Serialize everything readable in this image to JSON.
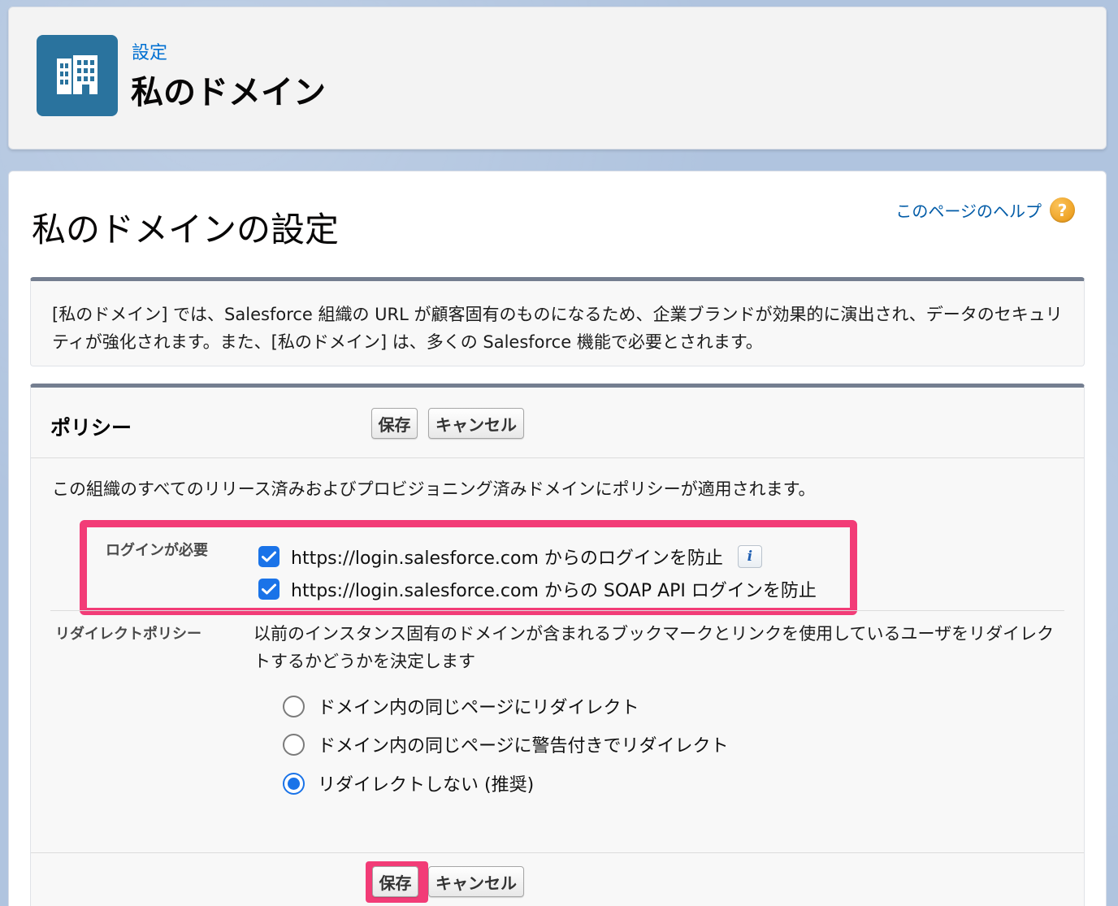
{
  "header": {
    "breadcrumb": "設定",
    "title": "私のドメイン",
    "icon": "building-icon"
  },
  "main": {
    "title": "私のドメインの設定",
    "help_link": "このページのヘルプ",
    "help_icon_glyph": "?",
    "info_text": "[私のドメイン] では、Salesforce 組織の URL が顧客固有のものになるため、企業ブランドが効果的に演出され、データのセキュリティが強化されます。また、[私のドメイン] は、多くの Salesforce 機能で必要とされます。"
  },
  "policy": {
    "title": "ポリシー",
    "save_label": "保存",
    "cancel_label": "キャンセル",
    "description": "この組織のすべてのリリース済みおよびプロビジョニング済みドメインにポリシーが適用されます。",
    "login_required": {
      "label": "ログインが必要",
      "options": [
        {
          "label": "https://login.salesforce.com からのログインを防止",
          "checked": true
        },
        {
          "label": "https://login.salesforce.com からの SOAP API ログインを防止",
          "checked": true
        }
      ],
      "info_glyph": "i"
    },
    "redirect_policy": {
      "label": "リダイレクトポリシー",
      "description": "以前のインスタンス固有のドメインが含まれるブックマークとリンクを使用しているユーザをリダイレクトするかどうかを決定します",
      "options": [
        {
          "label": "ドメイン内の同じページにリダイレクト",
          "selected": false
        },
        {
          "label": "ドメイン内の同じページに警告付きでリダイレクト",
          "selected": false
        },
        {
          "label": "リダイレクトしない (推奨)",
          "selected": true
        }
      ]
    }
  },
  "colors": {
    "accent": "#0070d2",
    "highlight": "#f23c77",
    "checkbox": "#1a73e8",
    "header_icon_bg": "#2a739e"
  }
}
